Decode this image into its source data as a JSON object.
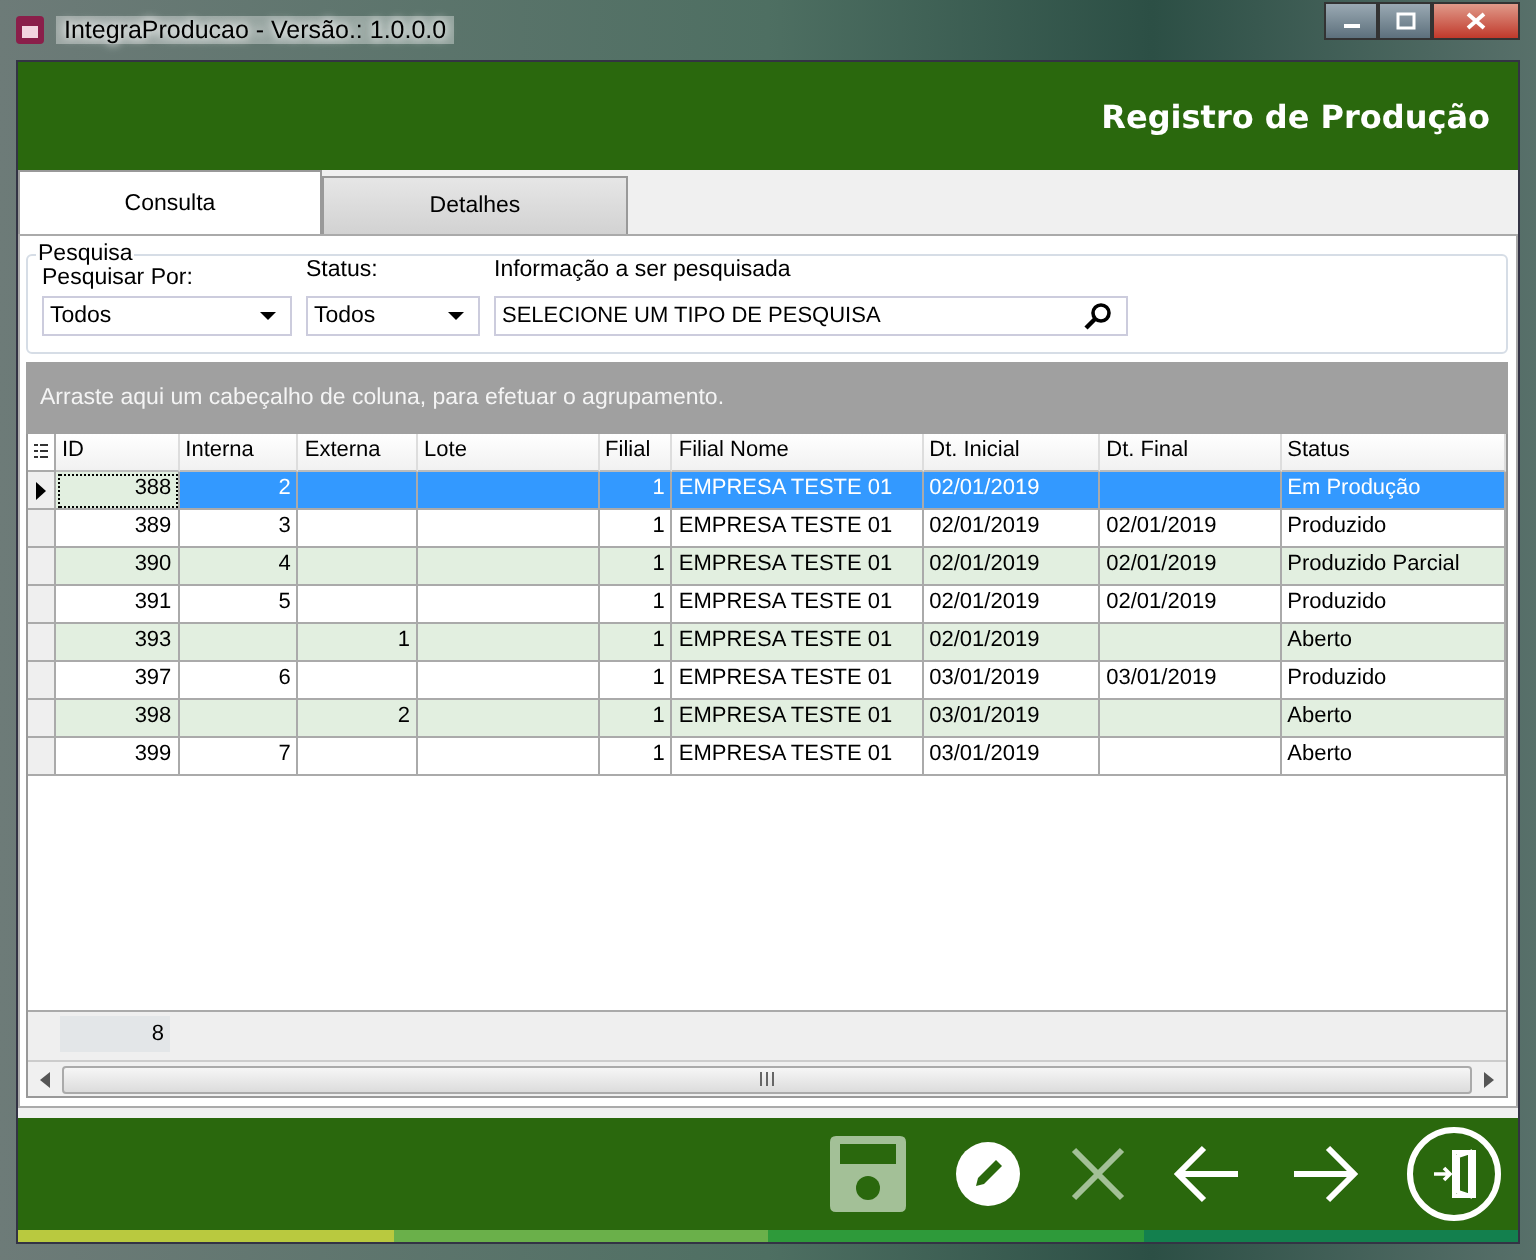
{
  "window": {
    "title": "IntegraProducao - Versão.: 1.0.0.0"
  },
  "header": {
    "title": "Registro de Produção"
  },
  "tabs": [
    {
      "label": "Consulta",
      "selected": true
    },
    {
      "label": "Detalhes",
      "selected": false
    }
  ],
  "search": {
    "group_label": "Pesquisa",
    "search_by": {
      "label": "Pesquisar Por:",
      "value": "Todos"
    },
    "status": {
      "label": "Status:",
      "value": "Todos"
    },
    "info": {
      "label": "Informação a ser pesquisada",
      "value": "SELECIONE UM TIPO DE PESQUISA"
    }
  },
  "group_panel": {
    "hint": "Arraste aqui um cabeçalho de coluna, para efetuar o agrupamento."
  },
  "table": {
    "columns": [
      {
        "label": "ID"
      },
      {
        "label": "Interna"
      },
      {
        "label": "Externa"
      },
      {
        "label": "Lote"
      },
      {
        "label": "Filial"
      },
      {
        "label": "Filial Nome"
      },
      {
        "label": "Dt. Inicial"
      },
      {
        "label": "Dt. Final"
      },
      {
        "label": "Status"
      }
    ],
    "rows": [
      {
        "selected": true,
        "cells": [
          "388",
          "2",
          "",
          "",
          "1",
          "EMPRESA TESTE 01",
          "02/01/2019",
          "",
          "Em Produção"
        ]
      },
      {
        "selected": false,
        "cells": [
          "389",
          "3",
          "",
          "",
          "1",
          "EMPRESA TESTE 01",
          "02/01/2019",
          "02/01/2019",
          "Produzido"
        ]
      },
      {
        "selected": false,
        "cells": [
          "390",
          "4",
          "",
          "",
          "1",
          "EMPRESA TESTE 01",
          "02/01/2019",
          "02/01/2019",
          "Produzido Parcial"
        ]
      },
      {
        "selected": false,
        "cells": [
          "391",
          "5",
          "",
          "",
          "1",
          "EMPRESA TESTE 01",
          "02/01/2019",
          "02/01/2019",
          "Produzido"
        ]
      },
      {
        "selected": false,
        "cells": [
          "393",
          "",
          "1",
          "",
          "1",
          "EMPRESA TESTE 01",
          "02/01/2019",
          "",
          "Aberto"
        ]
      },
      {
        "selected": false,
        "cells": [
          "397",
          "6",
          "",
          "",
          "1",
          "EMPRESA TESTE 01",
          "03/01/2019",
          "03/01/2019",
          "Produzido"
        ]
      },
      {
        "selected": false,
        "cells": [
          "398",
          "",
          "2",
          "",
          "1",
          "EMPRESA TESTE 01",
          "03/01/2019",
          "",
          "Aberto"
        ]
      },
      {
        "selected": false,
        "cells": [
          "399",
          "7",
          "",
          "",
          "1",
          "EMPRESA TESTE 01",
          "03/01/2019",
          "",
          "Aberto"
        ]
      }
    ],
    "footer_count": "8"
  },
  "toolbar": [
    {
      "kind": "save",
      "disabled": true
    },
    {
      "kind": "edit",
      "disabled": false
    },
    {
      "kind": "cancel",
      "disabled": true
    },
    {
      "kind": "back",
      "disabled": false
    },
    {
      "kind": "forward",
      "disabled": false
    },
    {
      "kind": "exit",
      "disabled": false
    }
  ]
}
